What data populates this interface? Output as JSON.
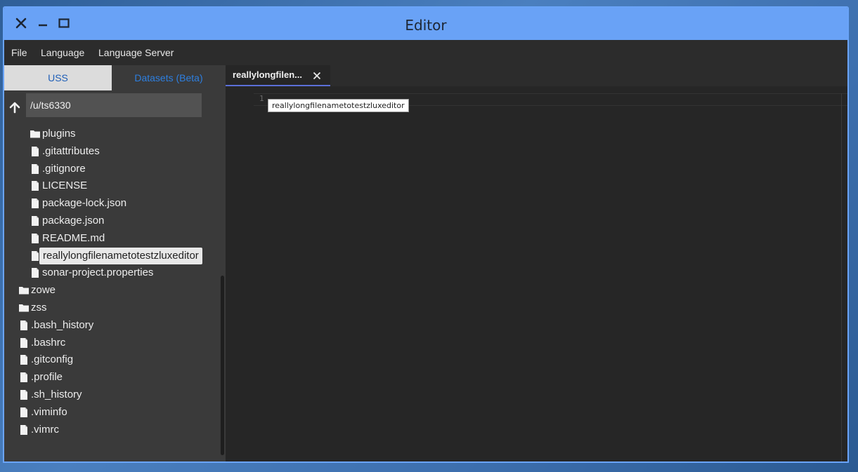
{
  "window": {
    "title": "Editor"
  },
  "menu": {
    "items": [
      "File",
      "Language",
      "Language Server"
    ]
  },
  "sidebar": {
    "tabs": [
      "USS",
      "Datasets (Beta)"
    ],
    "path": "/u/ts6330",
    "tree": [
      {
        "label": "plugins",
        "type": "folder",
        "depth": 1
      },
      {
        "label": ".gitattributes",
        "type": "file",
        "depth": 1
      },
      {
        "label": ".gitignore",
        "type": "file",
        "depth": 1
      },
      {
        "label": "LICENSE",
        "type": "file",
        "depth": 1
      },
      {
        "label": "package-lock.json",
        "type": "file",
        "depth": 1
      },
      {
        "label": "package.json",
        "type": "file",
        "depth": 1
      },
      {
        "label": "README.md",
        "type": "file",
        "depth": 1
      },
      {
        "label": "reallylongfilenametotestzluxeditor",
        "type": "file",
        "depth": 1,
        "selected": true
      },
      {
        "label": "sonar-project.properties",
        "type": "file",
        "depth": 1
      },
      {
        "label": "zowe",
        "type": "folder",
        "depth": 0
      },
      {
        "label": "zss",
        "type": "folder",
        "depth": 0
      },
      {
        "label": ".bash_history",
        "type": "file",
        "depth": 0
      },
      {
        "label": ".bashrc",
        "type": "file",
        "depth": 0
      },
      {
        "label": ".gitconfig",
        "type": "file",
        "depth": 0
      },
      {
        "label": ".profile",
        "type": "file",
        "depth": 0
      },
      {
        "label": ".sh_history",
        "type": "file",
        "depth": 0
      },
      {
        "label": ".viminfo",
        "type": "file",
        "depth": 0
      },
      {
        "label": ".vimrc",
        "type": "file",
        "depth": 0
      }
    ]
  },
  "editor": {
    "tab_label": "reallylongfilen...",
    "line_number": "1",
    "tooltip": "reallylongfilenametotestzluxeditor"
  },
  "colors": {
    "titlebar": "#69a2f6",
    "accent": "#2d7fe0",
    "tab_underline": "#5b6fd8"
  },
  "icons": {
    "close": "close-icon",
    "minimize": "minimize-icon",
    "maximize": "maximize-icon",
    "up": "arrow-up-icon",
    "folder": "folder-icon",
    "file": "file-icon"
  }
}
